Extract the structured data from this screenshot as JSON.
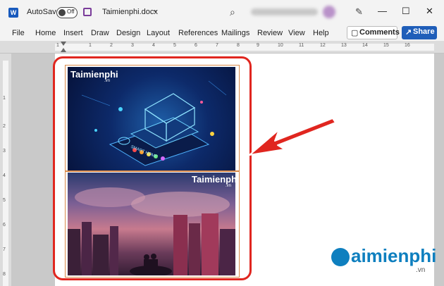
{
  "titlebar": {
    "app_icon": "W",
    "autosave_label": "AutoSave",
    "autosave_state": "Off",
    "filename": "Taimienphi.docx",
    "chevron": "⌄",
    "search_glyph": "⌕",
    "pen_glyph": "✎",
    "minimize": "—",
    "maximize": "☐",
    "close": "✕"
  },
  "menu": {
    "items": [
      "File",
      "Home",
      "Insert",
      "Draw",
      "Design",
      "Layout",
      "References",
      "Mailings",
      "Review",
      "View",
      "Help"
    ],
    "comments_label": "Comments",
    "share_label": "Share"
  },
  "ruler": {
    "top_labels": [
      "1",
      "1",
      "2",
      "3",
      "4",
      "5",
      "6",
      "7",
      "8",
      "9",
      "10",
      "11",
      "12",
      "13",
      "14",
      "15",
      "16"
    ],
    "left_labels": [
      "1",
      "2",
      "3",
      "4",
      "5",
      "6",
      "7",
      "8"
    ]
  },
  "document": {
    "image_top": {
      "logo": "Taimienphi",
      "logo_suffix": ".vn",
      "caption": "SMART HOME"
    },
    "image_bottom": {
      "logo": "Taimienphi",
      "logo_suffix": ".vn"
    }
  },
  "watermark": {
    "text": "aimienphi",
    "suffix": ".vn"
  },
  "colors": {
    "accent_red": "#e0261f",
    "word_blue": "#185abd",
    "share_blue": "#1f5eb9",
    "brand_blue": "#0e7fbf"
  }
}
